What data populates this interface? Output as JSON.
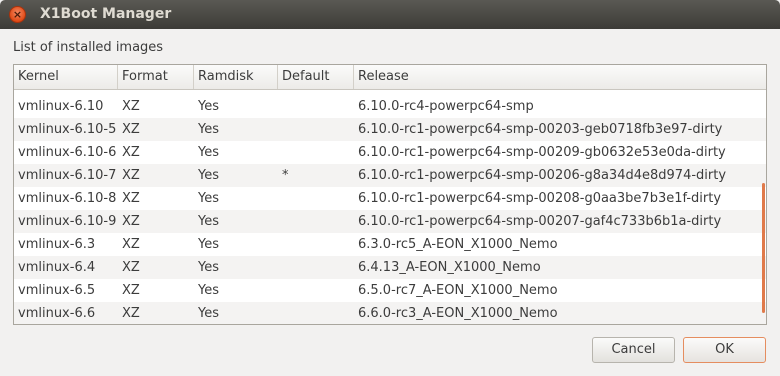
{
  "window": {
    "title": "X1Boot Manager",
    "close_symbol": "×"
  },
  "list_label": "List of installed images",
  "columns": [
    "Kernel",
    "Format",
    "Ramdisk",
    "Default",
    "Release"
  ],
  "rows": [
    {
      "kernel": "vmlinux-6.10",
      "format": "XZ",
      "ramdisk": "Yes",
      "default": "",
      "release": "6.10.0-rc4-powerpc64-smp"
    },
    {
      "kernel": "vmlinux-6.10-5",
      "format": "XZ",
      "ramdisk": "Yes",
      "default": "",
      "release": "6.10.0-rc1-powerpc64-smp-00203-geb0718fb3e97-dirty"
    },
    {
      "kernel": "vmlinux-6.10-6",
      "format": "XZ",
      "ramdisk": "Yes",
      "default": "",
      "release": "6.10.0-rc1-powerpc64-smp-00209-gb0632e53e0da-dirty"
    },
    {
      "kernel": "vmlinux-6.10-7",
      "format": "XZ",
      "ramdisk": "Yes",
      "default": "*",
      "release": "6.10.0-rc1-powerpc64-smp-00206-g8a34d4e8d974-dirty"
    },
    {
      "kernel": "vmlinux-6.10-8",
      "format": "XZ",
      "ramdisk": "Yes",
      "default": "",
      "release": "6.10.0-rc1-powerpc64-smp-00208-g0aa3be7b3e1f-dirty"
    },
    {
      "kernel": "vmlinux-6.10-9",
      "format": "XZ",
      "ramdisk": "Yes",
      "default": "",
      "release": "6.10.0-rc1-powerpc64-smp-00207-gaf4c733b6b1a-dirty"
    },
    {
      "kernel": "vmlinux-6.3",
      "format": "XZ",
      "ramdisk": "Yes",
      "default": "",
      "release": "6.3.0-rc5_A-EON_X1000_Nemo"
    },
    {
      "kernel": "vmlinux-6.4",
      "format": "XZ",
      "ramdisk": "Yes",
      "default": "",
      "release": "6.4.13_A-EON_X1000_Nemo"
    },
    {
      "kernel": "vmlinux-6.5",
      "format": "XZ",
      "ramdisk": "Yes",
      "default": "",
      "release": "6.5.0-rc7_A-EON_X1000_Nemo"
    },
    {
      "kernel": "vmlinux-6.6",
      "format": "XZ",
      "ramdisk": "Yes",
      "default": "",
      "release": "6.6.0-rc3_A-EON_X1000_Nemo"
    }
  ],
  "buttons": {
    "cancel": "Cancel",
    "ok": "OK"
  },
  "colors": {
    "accent": "#e07a4a",
    "titlebar": "#3c3b37"
  }
}
